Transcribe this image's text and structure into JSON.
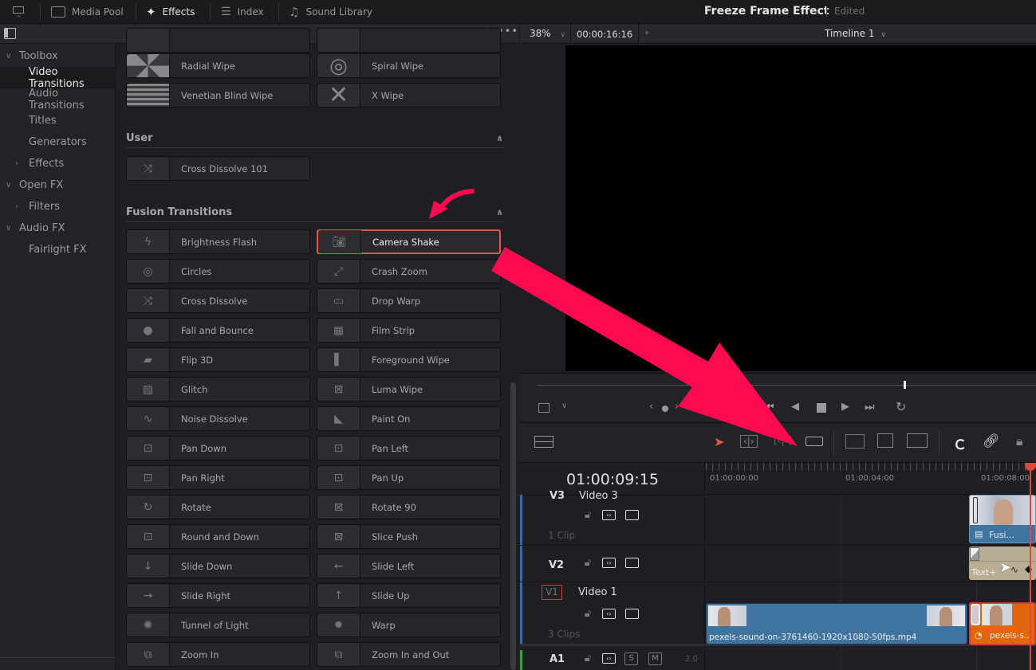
{
  "topbar": {
    "items": [
      {
        "label": "Media Pool",
        "icon": "media-pool-icon"
      },
      {
        "label": "Effects",
        "icon": "effects-wand-icon",
        "active": true
      },
      {
        "label": "Index",
        "icon": "index-list-icon"
      },
      {
        "label": "Sound Library",
        "icon": "sound-library-icon"
      }
    ],
    "project_title": "Freeze Frame Effect",
    "project_status": "Edited"
  },
  "viewer_bar": {
    "zoom": "38%",
    "timecode": "00:00:16:16",
    "timeline_name": "Timeline 1"
  },
  "sidebar": {
    "items": [
      {
        "label": "Toolbox",
        "level": 0,
        "expanded": true
      },
      {
        "label": "Video Transitions",
        "level": 1,
        "selected": true
      },
      {
        "label": "Audio Transitions",
        "level": 1
      },
      {
        "label": "Titles",
        "level": 1
      },
      {
        "label": "Generators",
        "level": 1
      },
      {
        "label": "Effects",
        "level": 1,
        "collapsed": true
      },
      {
        "label": "Open FX",
        "level": 0,
        "expanded": true
      },
      {
        "label": "Filters",
        "level": 1,
        "collapsed": true
      },
      {
        "label": "Audio FX",
        "level": 0,
        "expanded": true
      },
      {
        "label": "Fairlight FX",
        "level": 1
      }
    ]
  },
  "effects": {
    "top_rows": [
      [
        "Radial Wipe",
        "Spiral Wipe"
      ],
      [
        "Venetian Blind Wipe",
        "X Wipe"
      ]
    ],
    "user_section": {
      "title": "User",
      "items": [
        "Cross Dissolve 101"
      ]
    },
    "fusion_section": {
      "title": "Fusion Transitions",
      "selected": "Camera Shake",
      "rows": [
        [
          "Brightness Flash",
          "Camera Shake"
        ],
        [
          "Circles",
          "Crash Zoom"
        ],
        [
          "Cross Dissolve",
          "Drop Warp"
        ],
        [
          "Fall and Bounce",
          "Film Strip"
        ],
        [
          "Flip 3D",
          "Foreground Wipe"
        ],
        [
          "Glitch",
          "Luma Wipe"
        ],
        [
          "Noise Dissolve",
          "Paint On"
        ],
        [
          "Pan Down",
          "Pan Left"
        ],
        [
          "Pan Right",
          "Pan Up"
        ],
        [
          "Rotate",
          "Rotate 90"
        ],
        [
          "Round and Down",
          "Slice Push"
        ],
        [
          "Slide Down",
          "Slide Left"
        ],
        [
          "Slide Right",
          "Slide Up"
        ],
        [
          "Tunnel of Light",
          "Warp"
        ],
        [
          "Zoom In",
          "Zoom In and Out"
        ]
      ]
    }
  },
  "timeline": {
    "current_timecode": "01:00:09:15",
    "ruler_labels": [
      "01:00:00:00",
      "01:00:04:00",
      "01:00:08:00"
    ],
    "tracks": [
      {
        "id": "V3",
        "name": "Video 3",
        "clips_count": "1 Clip"
      },
      {
        "id": "V2",
        "name": "",
        "clips_count": ""
      },
      {
        "id": "V1",
        "name": "Video 1",
        "clips_count": "3 Clips"
      },
      {
        "id": "A1",
        "name": "",
        "channel": "2.0",
        "solo": "S",
        "mute": "M"
      }
    ],
    "clips": {
      "v3_clip": "Fusi...",
      "v2_clip": "Text+",
      "v1_main": "pexels-sound-on-3761460-1920x1080-50fps.mp4",
      "v1_second": "pexels-s..."
    }
  },
  "colors": {
    "accent_arrow": "#ff0a50",
    "selection_border": "#e0564e",
    "playhead": "#e0463c",
    "clip_blue": "#3f73a0",
    "clip_orange": "#e0660f",
    "clip_tan": "#b8ae94"
  }
}
